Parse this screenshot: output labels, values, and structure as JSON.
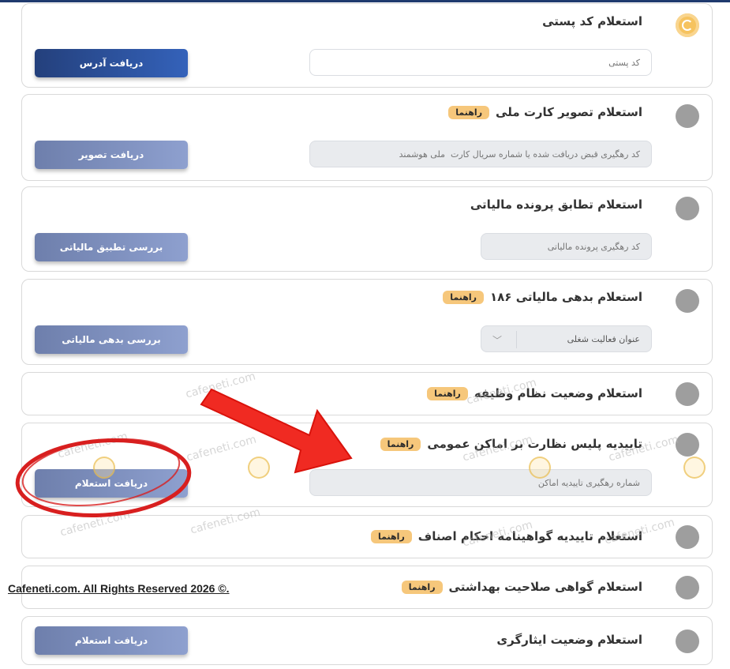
{
  "cards": [
    {
      "title": "استعلام کد پستی",
      "badge": "",
      "field": "کد پستی",
      "button": "دریافت آدرس"
    },
    {
      "title": "استعلام تصویر کارت ملی",
      "badge": "راهنما",
      "field": "کد رهگیری قبض دریافت شده یا شماره سریال کارت  ملی هوشمند",
      "button": "دریافت تصویر"
    },
    {
      "title": "استعلام تطابق پرونده مالیاتی",
      "badge": "",
      "field": "کد رهگیری پرونده مالیاتی",
      "button": "بررسی تطبیق مالیاتی"
    },
    {
      "title": "استعلام بدهی مالیاتی ۱۸۶",
      "badge": "راهنما",
      "field": "عنوان فعالیت شغلی",
      "button": "بررسی بدهی مالیاتی"
    },
    {
      "title": "استعلام وضعیت نظام وظیفه",
      "badge": "راهنما"
    },
    {
      "title": "تاییدیه پلیس نظارت بر اماکن عمومی",
      "badge": "راهنما",
      "field": "شماره رهگیری تاییدیه اماکن",
      "button": "دریافت استعلام"
    },
    {
      "title": "استعلام تاییدیه گواهینامه احکام اصناف",
      "badge": "راهنما"
    },
    {
      "title": "استعلام گواهی صلاحیت بهداشتی",
      "badge": "راهنما"
    },
    {
      "title": "استعلام وضعیت ایثارگری",
      "badge": "",
      "button": "دریافت استعلام"
    }
  ],
  "watermark": "cafeneti.com",
  "footer": {
    "copyright": "Cafeneti.com. All Rights Reserved 2026 ©."
  }
}
